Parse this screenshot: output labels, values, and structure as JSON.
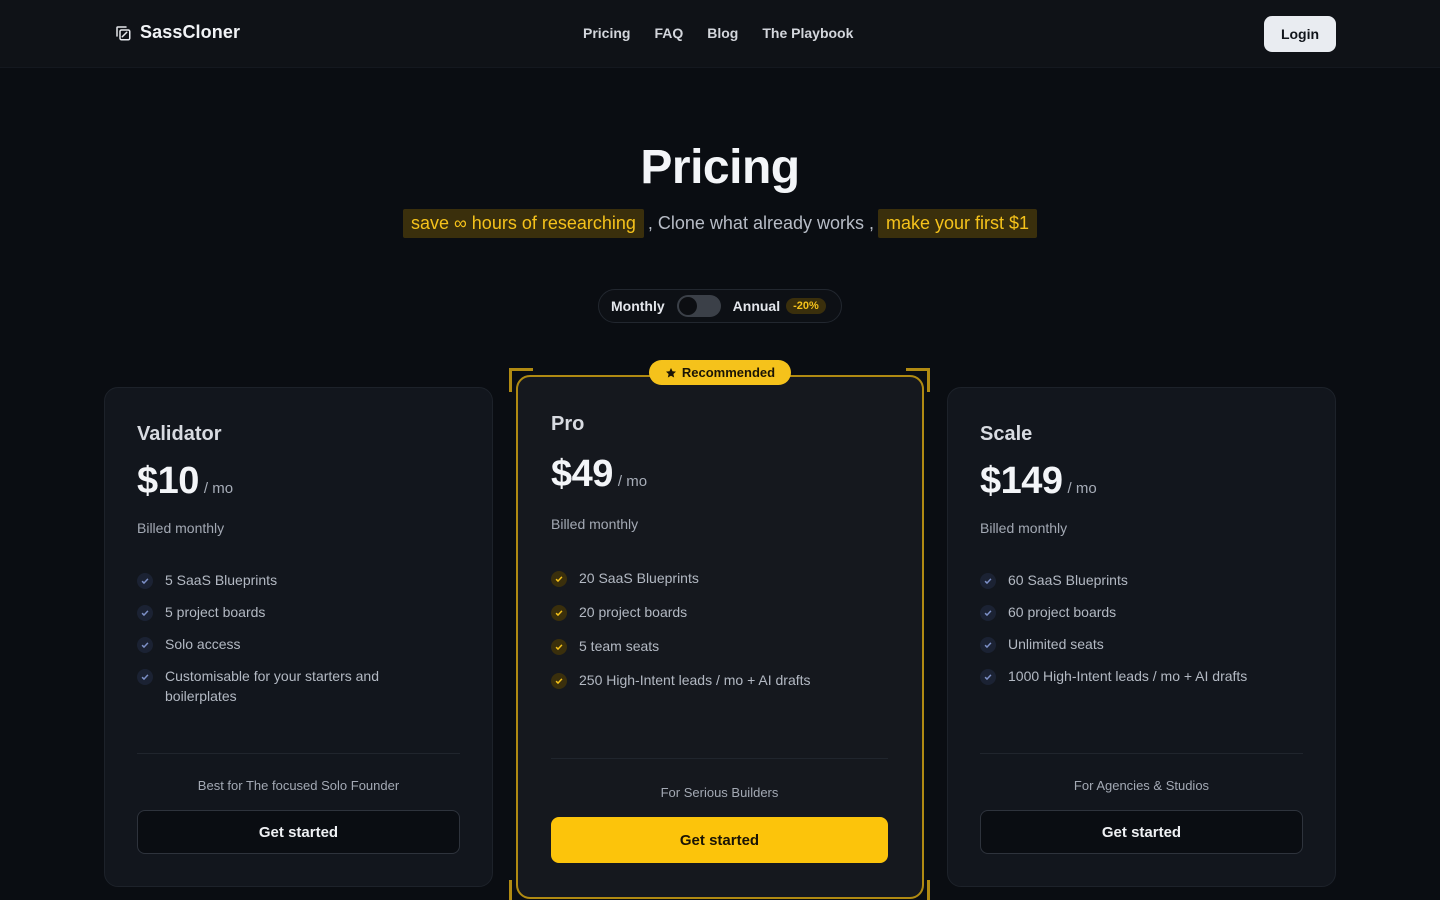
{
  "nav": {
    "brand": "SassCloner",
    "links": [
      "Pricing",
      "FAQ",
      "Blog",
      "The Playbook"
    ],
    "login": "Login"
  },
  "hero": {
    "title": "Pricing",
    "highlight1": "save ∞ hours of researching",
    "middle": ", Clone what already works ,",
    "highlight2": "make your first $1"
  },
  "billing_toggle": {
    "monthly": "Monthly",
    "annual": "Annual",
    "discount": "-20%",
    "annual_selected": false
  },
  "plans": [
    {
      "name": "Validator",
      "price": "$10",
      "period": "/ mo",
      "billed": "Billed monthly",
      "features": [
        "5 SaaS Blueprints",
        "5 project boards",
        "Solo access",
        "Customisable for your starters and boilerplates"
      ],
      "best_for": "Best for The focused Solo Founder",
      "cta": "Get started"
    },
    {
      "name": "Pro",
      "badge": "Recommended",
      "price": "$49",
      "period": "/ mo",
      "billed": "Billed monthly",
      "features": [
        "20 SaaS Blueprints",
        "20 project boards",
        "5 team seats",
        "250 High-Intent leads / mo + AI drafts"
      ],
      "best_for": "For Serious Builders",
      "cta": "Get started"
    },
    {
      "name": "Scale",
      "price": "$149",
      "period": "/ mo",
      "billed": "Billed monthly",
      "features": [
        "60 SaaS Blueprints",
        "60 project boards",
        "Unlimited seats",
        "1000 High-Intent leads / mo + AI drafts"
      ],
      "best_for": "For Agencies & Studios",
      "cta": "Get started"
    }
  ],
  "colors": {
    "background": "#0a0d12",
    "accent": "#fcc40b",
    "card": "#12161d",
    "highlight_bg": "#3a2f0c"
  },
  "icons": {
    "brand": "copy-icon",
    "badge": "star-icon",
    "feature": "check-icon"
  }
}
